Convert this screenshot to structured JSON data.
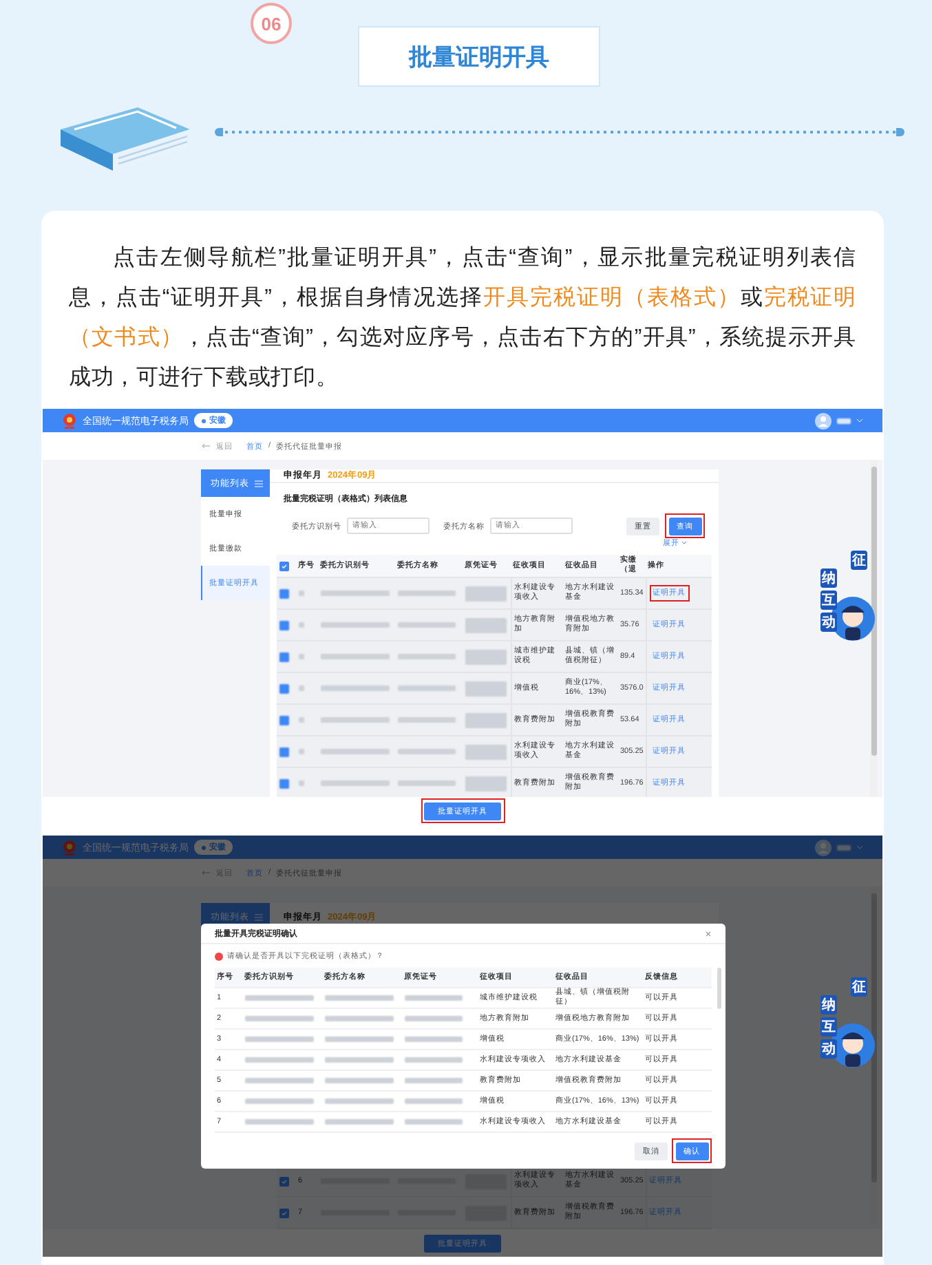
{
  "step": {
    "number": "06",
    "title": "批量证明开具"
  },
  "instruction": [
    {
      "text": "点击左侧导航栏”批量证明开具”，点击“查询”，显示批量完税证明列表信息，点击“证明开具”，根据自身情况选择",
      "emphasis": false
    },
    {
      "text": "开具完税证明（表格式）",
      "emphasis": true
    },
    {
      "text": "或",
      "emphasis": false
    },
    {
      "text": "完税证明（文书式）",
      "emphasis": true
    },
    {
      "text": "，点击“查询”，勾选对应序号，点击右下方的”开具”，系统提示开具成功，可进行下载或打印。",
      "emphasis": false
    }
  ],
  "screenshot_1": {
    "portal": {
      "title": "全国统一规范电子税务局",
      "region": "安徽"
    },
    "breadcrumb": {
      "back": "返回",
      "home": "首页",
      "separator": "/",
      "current": "委托代征批量申报"
    },
    "sidebar": {
      "title": "功能列表",
      "items": [
        {
          "label": "批量申报",
          "selected": false
        },
        {
          "label": "批量缴款",
          "selected": false
        },
        {
          "label": "批量证明开具",
          "selected": true
        }
      ]
    },
    "period": {
      "label": "申报年月",
      "value": "2024年09月"
    },
    "list_title": "批量完税证明（表格式）列表信息",
    "filters": [
      {
        "label": "委托方识别号",
        "placeholder": "请输入"
      },
      {
        "label": "委托方名称",
        "placeholder": "请输入"
      }
    ],
    "reset_button": {
      "label": "重置"
    },
    "query_button": {
      "label": "查询",
      "highlighted": true
    },
    "expand_link": "展开",
    "select_all_checked": true,
    "columns": [
      "序号",
      "委托方识别号",
      "委托方名称",
      "原凭证号",
      "征收项目",
      "征收品目",
      "实缴（退",
      "操作"
    ],
    "rows": [
      {
        "checked": true,
        "item": "水利建设专项收入",
        "category": "地方水利建设基金",
        "amount": "135.34",
        "action": "证明开具",
        "highlighted": true
      },
      {
        "checked": true,
        "item": "地方教育附加",
        "category": "增值税地方教育附加",
        "amount": "35.76",
        "action": "证明开具",
        "highlighted": false
      },
      {
        "checked": true,
        "item": "城市维护建设税",
        "category": "县城、镇（增值税附征）",
        "amount": "89.4",
        "action": "证明开具",
        "highlighted": false
      },
      {
        "checked": true,
        "item": "增值税",
        "category": "商业(17%、16%、13%)",
        "amount": "3576.0",
        "action": "证明开具",
        "highlighted": false
      },
      {
        "checked": true,
        "item": "教育费附加",
        "category": "增值税教育费附加",
        "amount": "53.64",
        "action": "证明开具",
        "highlighted": false
      },
      {
        "checked": true,
        "item": "水利建设专项收入",
        "category": "地方水利建设基金",
        "amount": "305.25",
        "action": "证明开具",
        "highlighted": false
      },
      {
        "checked": true,
        "item": "教育费附加",
        "category": "增值税教育费附加",
        "amount": "196.76",
        "action": "证明开具",
        "highlighted": false
      }
    ],
    "batch_button": {
      "label": "批量证明开具",
      "highlighted": true
    },
    "mascot": [
      "征",
      "纳",
      "互",
      "动"
    ]
  },
  "screenshot_2": {
    "portal": {
      "title": "全国统一规范电子税务局",
      "region": "安徽"
    },
    "breadcrumb": {
      "back": "返回",
      "home": "首页",
      "separator": "/",
      "current": "委托代征批量申报"
    },
    "sidebar_title": "功能列表",
    "period": {
      "label": "申报年月",
      "value": "2024年09月"
    },
    "rows": [
      {
        "checked": true,
        "seq": "6",
        "item": "水利建设专项收入",
        "category": "地方水利建设基金",
        "amount": "305.25",
        "action": "证明开具"
      },
      {
        "checked": true,
        "seq": "7",
        "item": "教育费附加",
        "category": "增值税教育费附加",
        "amount": "196.76",
        "action": "证明开具"
      }
    ],
    "batch_button": {
      "label": "批量证明开具",
      "highlighted": false
    },
    "dialog": {
      "title": "批量开具完税证明确认",
      "message": "请确认是否开具以下完税证明（表格式）？",
      "columns": [
        "序号",
        "委托方识别号",
        "委托方名称",
        "原凭证号",
        "征收项目",
        "征收品目",
        "反馈信息"
      ],
      "rows": [
        {
          "seq": "1",
          "item": "城市维护建设税",
          "category": "县城、镇（增值税附征）",
          "feedback": "可以开具"
        },
        {
          "seq": "2",
          "item": "地方教育附加",
          "category": "增值税地方教育附加",
          "feedback": "可以开具"
        },
        {
          "seq": "3",
          "item": "增值税",
          "category": "商业(17%、16%、13%)",
          "feedback": "可以开具"
        },
        {
          "seq": "4",
          "item": "水利建设专项收入",
          "category": "地方水利建设基金",
          "feedback": "可以开具"
        },
        {
          "seq": "5",
          "item": "教育费附加",
          "category": "增值税教育费附加",
          "feedback": "可以开具"
        },
        {
          "seq": "6",
          "item": "增值税",
          "category": "商业(17%、16%、13%)",
          "feedback": "可以开具"
        },
        {
          "seq": "7",
          "item": "水利建设专项收入",
          "category": "地方水利建设基金",
          "feedback": "可以开具"
        }
      ],
      "cancel_button": {
        "label": "取消"
      },
      "confirm_button": {
        "label": "确认",
        "highlighted": true
      }
    },
    "mascot": [
      "征",
      "纳",
      "互",
      "动"
    ]
  }
}
